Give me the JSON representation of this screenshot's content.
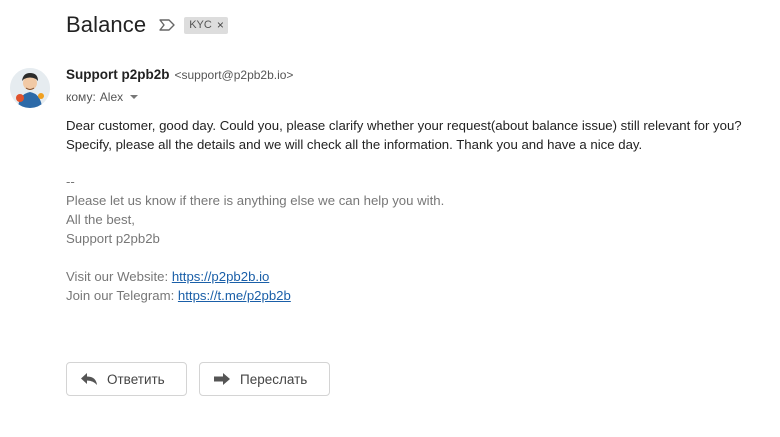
{
  "subject": {
    "title": "Balance",
    "label_chip": "KYC",
    "chip_remove": "×",
    "icons": {
      "label": "label-arrow-icon",
      "chip_remove": "close-icon"
    }
  },
  "message": {
    "sender_name": "Support p2pb2b",
    "sender_email": "<support@p2pb2b.io>",
    "to_prefix": "кому:",
    "to_name": "Alex",
    "body_line1": "Dear customer, good day. Could you, please clarify whether your request(about balance issue) still relevant for you?",
    "body_line2": "Specify, please all the details and we will check all the information. Thank you and have a nice day.",
    "signature": {
      "separator": "--",
      "line1": "Please let us know if there is anything else we can help you with.",
      "line2": "All the best,",
      "line3": "Support p2pb2b",
      "website_label": "Visit our Website:",
      "website_link": "https://p2pb2b.io",
      "telegram_label": "Join our Telegram:",
      "telegram_link": "https://t.me/p2pb2b"
    }
  },
  "actions": {
    "reply_label": "Ответить",
    "forward_label": "Переслать",
    "icons": {
      "reply": "reply-arrow-icon",
      "forward": "forward-arrow-icon"
    }
  },
  "colors": {
    "text": "#222222",
    "muted": "#777777",
    "link": "#1a5fa8",
    "chip_bg": "#dddddd",
    "button_border": "#d4d4d4"
  }
}
